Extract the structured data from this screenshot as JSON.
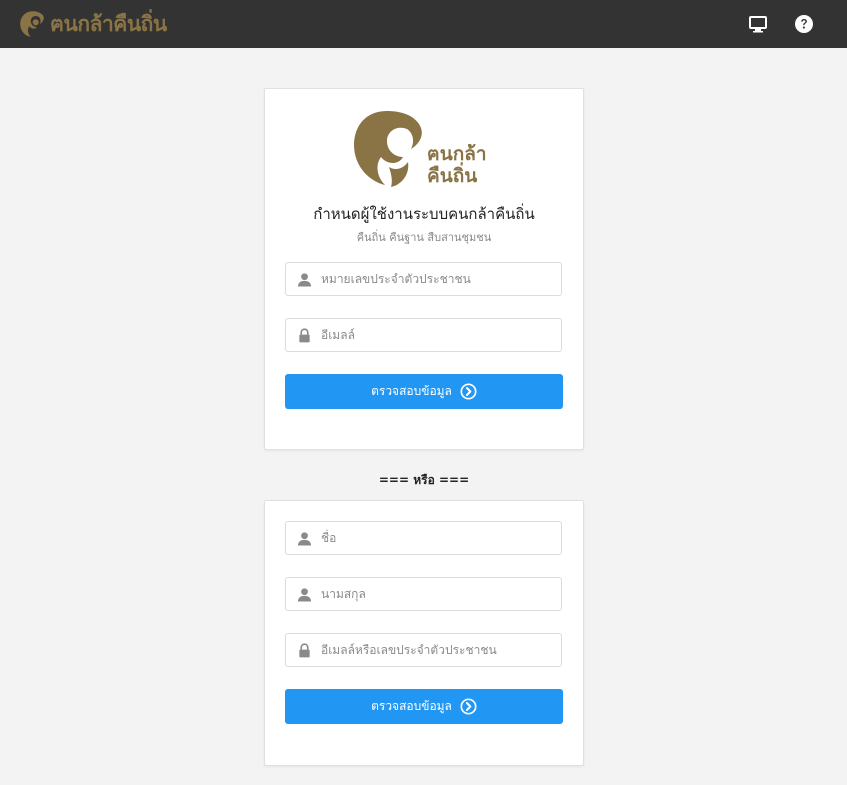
{
  "app": {
    "brand_text": "ฅนกล้าคืนถิ่น",
    "accent_color": "#8a7446",
    "primary_button_color": "#2196f3"
  },
  "topbar": {
    "icons": [
      "monitor-icon",
      "help-icon"
    ]
  },
  "card_one": {
    "logo_line_1": "ฅนกล้า",
    "logo_line_2": "คืนถิ่น",
    "title": "กำหนดผู้ใช้งานระบบคนกล้าคืนถิ่น",
    "subtitle": "คืนถิ่น คืนฐาน สืบสานชุมชน",
    "fields": [
      {
        "icon": "user-icon",
        "placeholder": "หมายเลขประจำตัวประชาชน",
        "value": ""
      },
      {
        "icon": "lock-icon",
        "placeholder": "อีเมลล์",
        "value": ""
      }
    ],
    "button_label": "ตรวจสอบข้อมูล"
  },
  "divider": "=== หรือ ===",
  "card_two": {
    "fields": [
      {
        "icon": "user-icon",
        "placeholder": "ชื่อ",
        "value": ""
      },
      {
        "icon": "user-icon",
        "placeholder": "นามสกุล",
        "value": ""
      },
      {
        "icon": "lock-icon",
        "placeholder": "อีเมลล์หรือเลขประจำตัวประชาชน",
        "value": ""
      }
    ],
    "button_label": "ตรวจสอบข้อมูล"
  }
}
